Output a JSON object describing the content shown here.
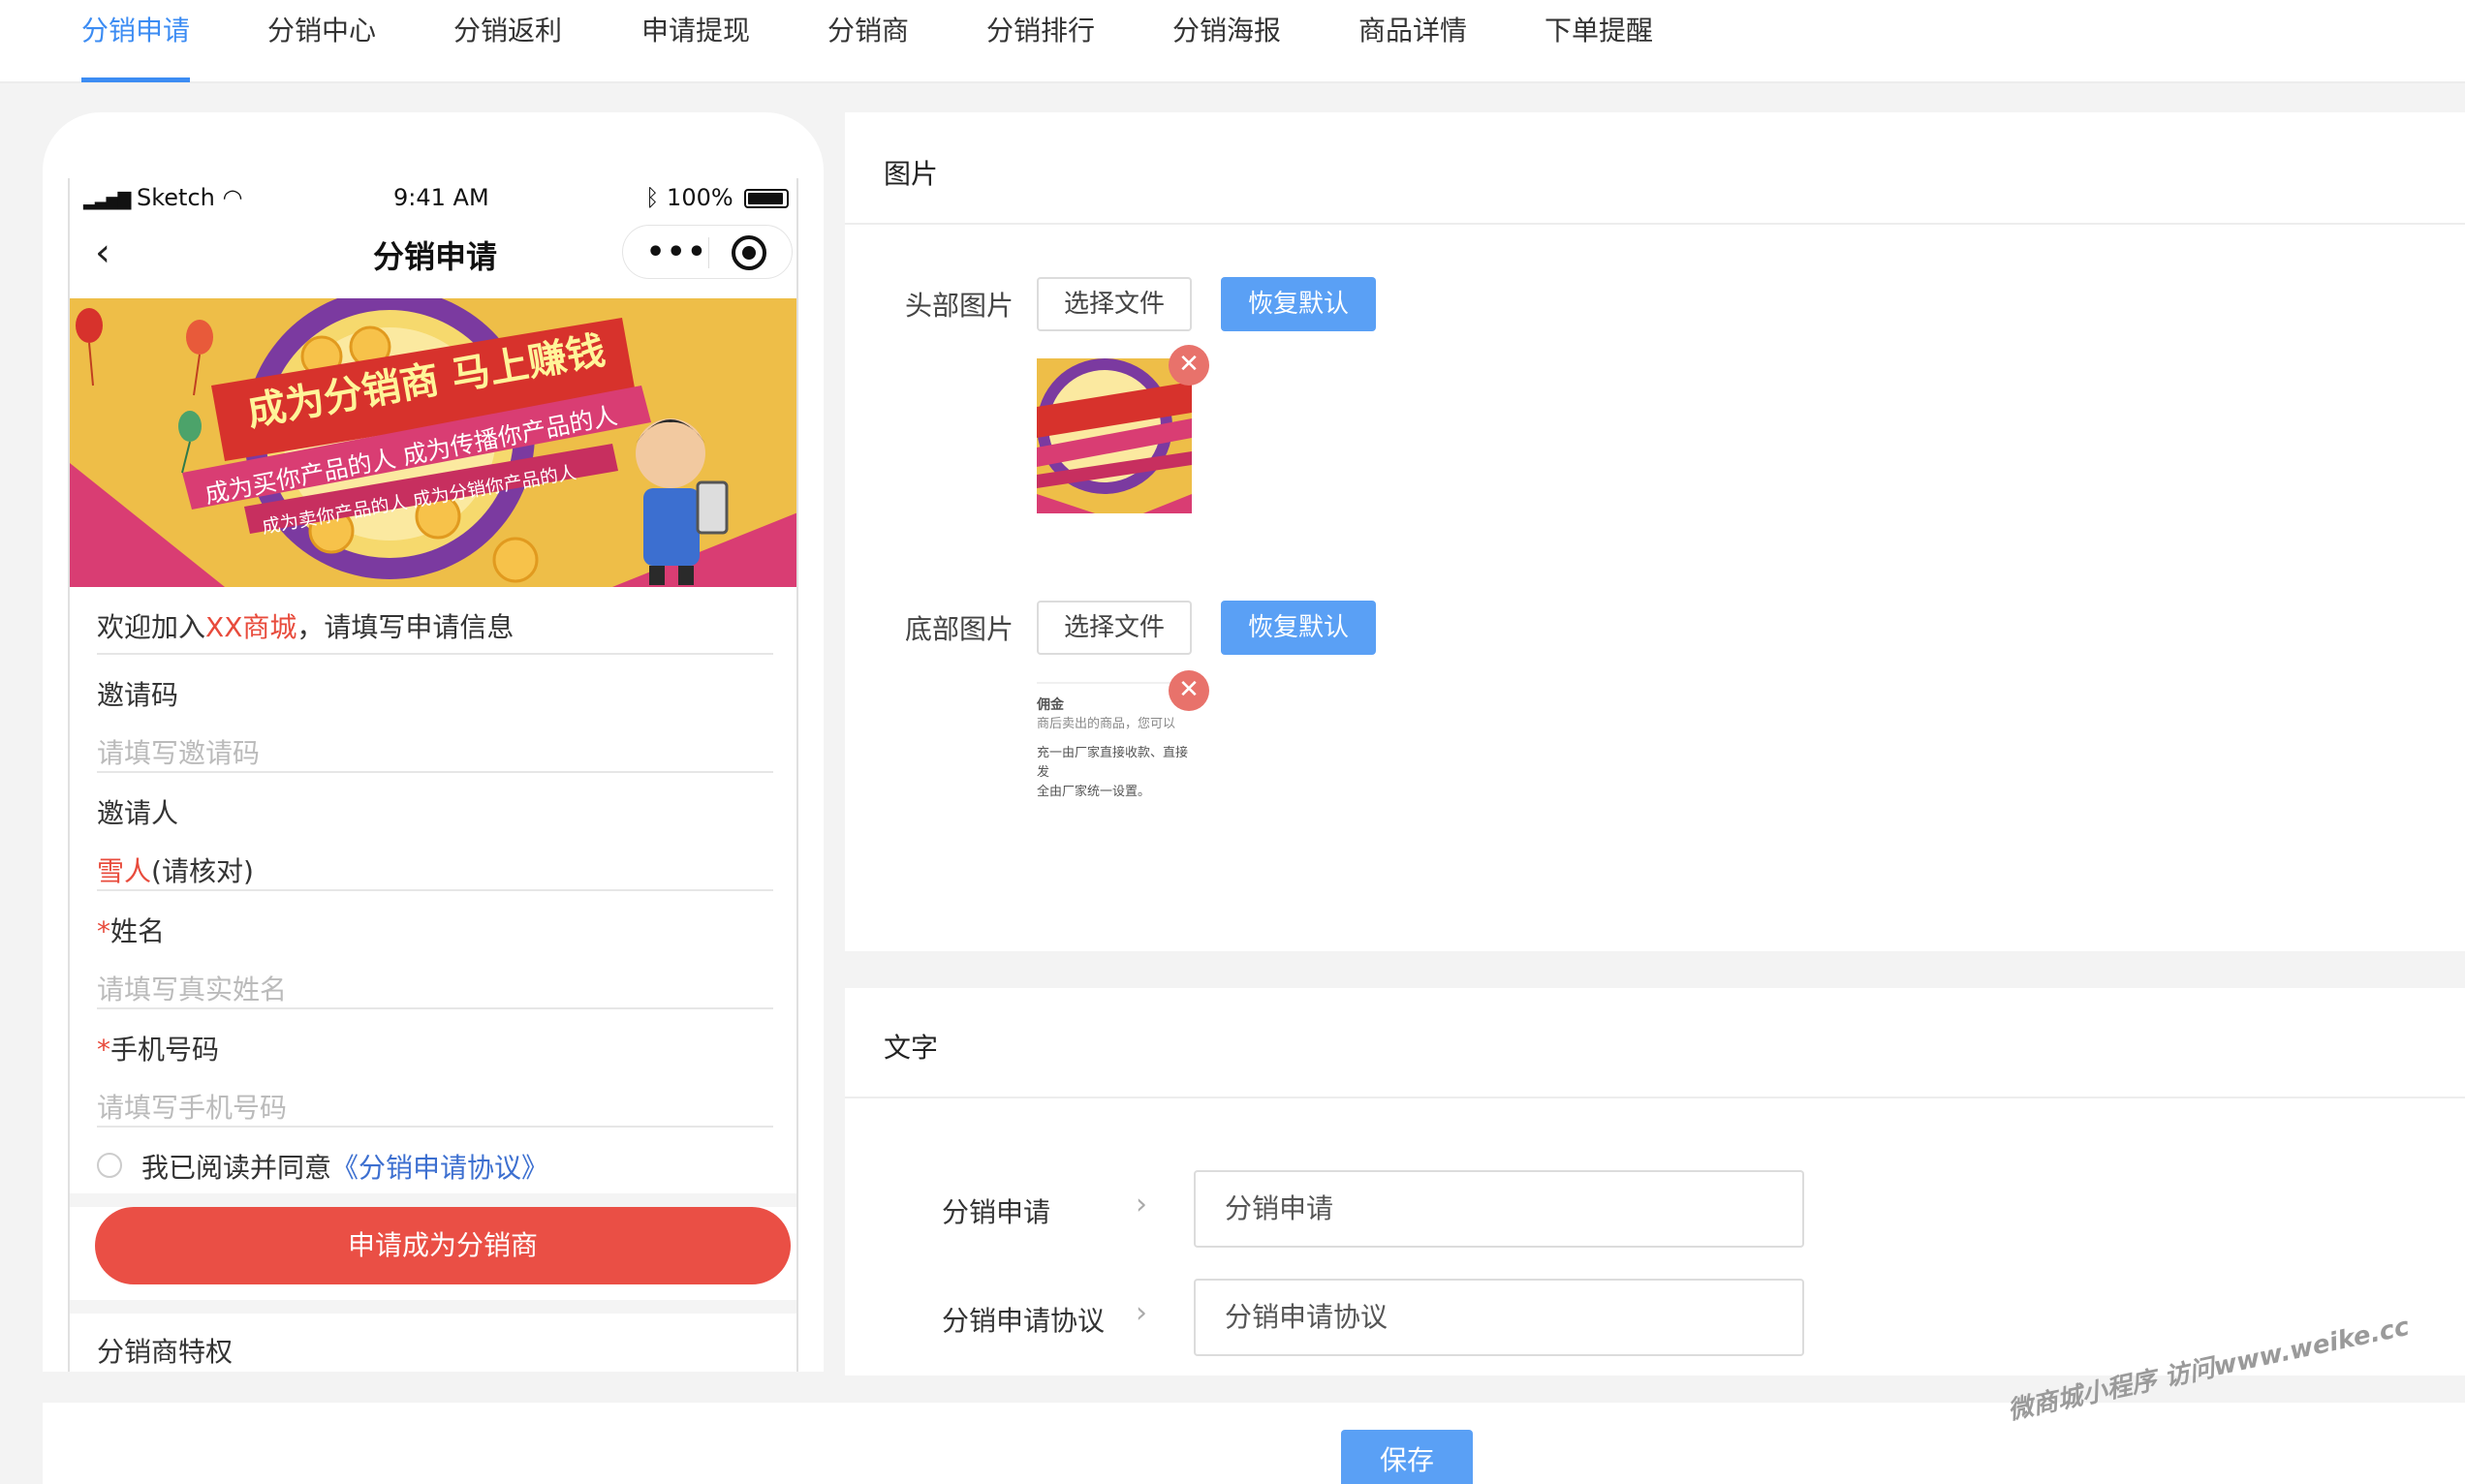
{
  "tabs": [
    {
      "label": "分销申请",
      "active": true
    },
    {
      "label": "分销中心"
    },
    {
      "label": "分销返利"
    },
    {
      "label": "申请提现"
    },
    {
      "label": "分销商"
    },
    {
      "label": "分销排行"
    },
    {
      "label": "分销海报"
    },
    {
      "label": "商品详情"
    },
    {
      "label": "下单提醒"
    }
  ],
  "phone": {
    "status": {
      "carrier": "Sketch",
      "time": "9:41 AM",
      "battery": "100%"
    },
    "nav_title": "分销申请",
    "banner": {
      "headline": "成为分销商 马上赚钱",
      "line1": "成为买你产品的人 成为传播你产品的人",
      "line2": "成为卖你产品的人 成为分销你产品的人"
    },
    "welcome_prefix": "欢迎加入",
    "welcome_shop": "XX商城",
    "welcome_suffix": "，请填写申请信息",
    "invite_code_label": "邀请码",
    "invite_code_placeholder": "请填写邀请码",
    "inviter_label": "邀请人",
    "inviter_name": "雪人",
    "inviter_note": "(请核对)",
    "name_label": "姓名",
    "name_placeholder": "请填写真实姓名",
    "phone_label": "手机号码",
    "phone_placeholder": "请填写手机号码",
    "required_mark": "*",
    "agree_text": "我已阅读并同意",
    "agree_link": "《分销申请协议》",
    "apply_button": "申请成为分销商",
    "privilege_title": "分销商特权"
  },
  "image_panel": {
    "title": "图片",
    "header_label": "头部图片",
    "footer_label": "底部图片",
    "choose_file": "选择文件",
    "restore_default": "恢复默认",
    "close_glyph": "✕",
    "footer_thumb_lines": [
      "佣金",
      "商后卖出的商品，您可以",
      "充一由厂家直接收款、直接发",
      "全由厂家统一设置。"
    ]
  },
  "text_panel": {
    "title": "文字",
    "rows": [
      {
        "label": "分销申请",
        "value": "分销申请"
      },
      {
        "label": "分销申请协议",
        "value": "分销申请协议"
      }
    ]
  },
  "save_button": "保存",
  "watermark": "微商城小程序 访问www.weike.cc"
}
